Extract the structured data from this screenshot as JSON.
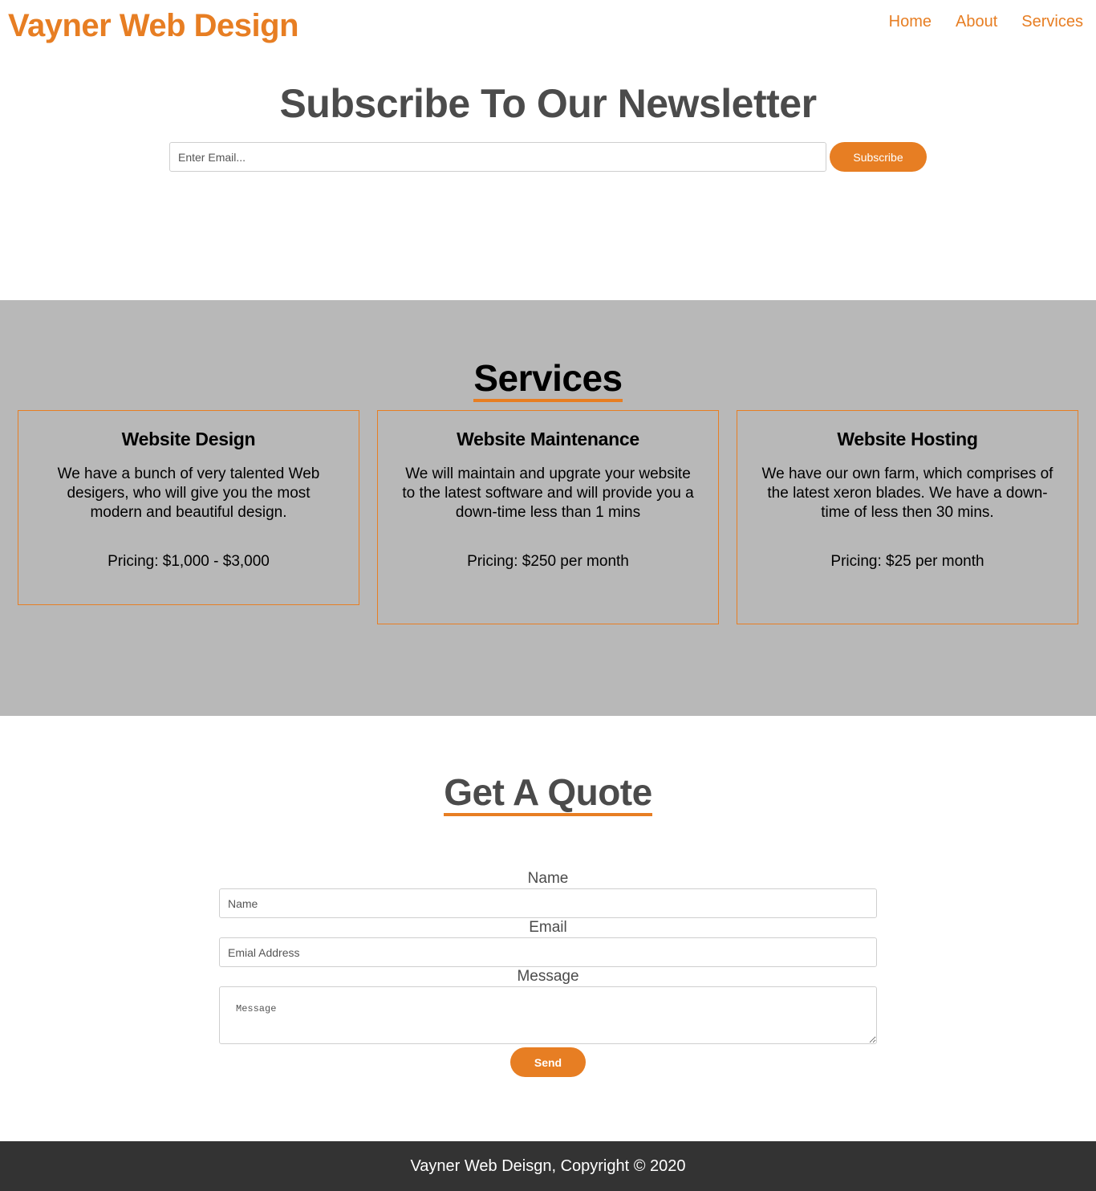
{
  "header": {
    "logo": "Vayner Web Design",
    "nav": [
      "Home",
      "About",
      "Services"
    ]
  },
  "newsletter": {
    "title": "Subscribe To Our Newsletter",
    "email_placeholder": "Enter Email...",
    "subscribe_label": "Subscribe"
  },
  "services": {
    "title": "Services",
    "cards": [
      {
        "title": "Website Design",
        "description": "We have a bunch of very talented Web desigers, who will give you the most modern and beautiful design.",
        "pricing": "Pricing: $1,000 - $3,000"
      },
      {
        "title": "Website Maintenance",
        "description": "We will maintain and upgrate your website to the latest software and will provide you a down-time less than 1 mins",
        "pricing": "Pricing: $250 per month"
      },
      {
        "title": "Website Hosting",
        "description": "We have our own farm, which comprises of the latest xeron blades. We have a down-time of less then 30 mins.",
        "pricing": "Pricing: $25 per month"
      }
    ]
  },
  "quote": {
    "title": "Get A Quote",
    "name_label": "Name",
    "name_placeholder": "Name",
    "email_label": "Email",
    "email_placeholder": "Emial Address",
    "message_label": "Message",
    "message_placeholder": "Message",
    "send_label": "Send"
  },
  "footer": {
    "text": "Vayner Web Deisgn, Copyright © 2020"
  },
  "colors": {
    "accent": "#e77e23",
    "services_bg": "#b8b8b8",
    "footer_bg": "#333333",
    "heading": "#4b4b4b"
  }
}
